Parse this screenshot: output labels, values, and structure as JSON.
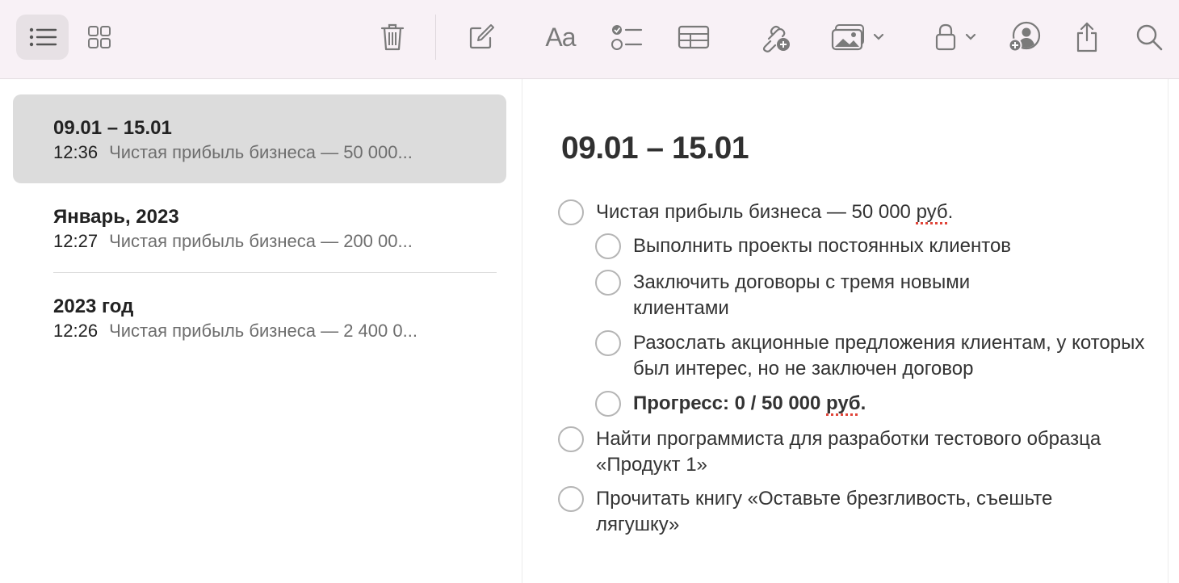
{
  "toolbar": {
    "buttons": [
      {
        "name": "list-view",
        "icon": "list-icon",
        "active": true
      },
      {
        "name": "gallery-view",
        "icon": "grid-icon",
        "active": false
      },
      {
        "name": "delete",
        "icon": "trash-icon"
      },
      {
        "name": "new-note",
        "icon": "compose-icon"
      },
      {
        "name": "format",
        "icon": "text-format-icon",
        "label": "Aa"
      },
      {
        "name": "checklist",
        "icon": "checklist-icon"
      },
      {
        "name": "table",
        "icon": "table-icon"
      },
      {
        "name": "link",
        "icon": "link-add-icon"
      },
      {
        "name": "media",
        "icon": "photo-icon"
      },
      {
        "name": "lock",
        "icon": "lock-icon"
      },
      {
        "name": "collaborate",
        "icon": "add-person-icon"
      },
      {
        "name": "share",
        "icon": "share-icon"
      },
      {
        "name": "search",
        "icon": "search-icon"
      }
    ],
    "format_label": "Aa",
    "colors": {
      "background": "#f8f1f6",
      "icon": "#7a7a7a",
      "active": "#e7e1e5"
    }
  },
  "notes": [
    {
      "title": "09.01 – 15.01",
      "time": "12:36",
      "preview": "Чистая прибыль бизнеса — 50 000...",
      "selected": true
    },
    {
      "title": "Январь, 2023",
      "time": "12:27",
      "preview": "Чистая прибыль бизнеса — 200 00...",
      "selected": false
    },
    {
      "title": "2023 год",
      "time": "12:26",
      "preview": "Чистая прибыль бизнеса — 2 400 0...",
      "selected": false
    }
  ],
  "editor": {
    "title": "09.01 – 15.01",
    "checklist": [
      {
        "level": 1,
        "text": "Чистая прибыль бизнеса — 50 000 ",
        "spell_word": "руб",
        "suffix": ".",
        "checked": false
      },
      {
        "level": 2,
        "text": "Выполнить проекты постоянных клиентов",
        "checked": false
      },
      {
        "level": 2,
        "text": "Заключить договоры с тремя новыми клиентами",
        "checked": false
      },
      {
        "level": 2,
        "text": "Разослать акционные предложения клиентам, у которых был интерес, но не заключен договор",
        "checked": false
      },
      {
        "level": 2,
        "text": "Прогресс: 0 / 50 000 ",
        "spell_word": "руб",
        "suffix": ".",
        "bold": true,
        "checked": false
      },
      {
        "level": 1,
        "text": "Найти программиста для разработки тестового образца «Продукт 1»",
        "checked": false
      },
      {
        "level": 1,
        "text": "Прочитать книгу «Оставьте брезгливость, съешьте лягушку»",
        "checked": false
      }
    ]
  }
}
